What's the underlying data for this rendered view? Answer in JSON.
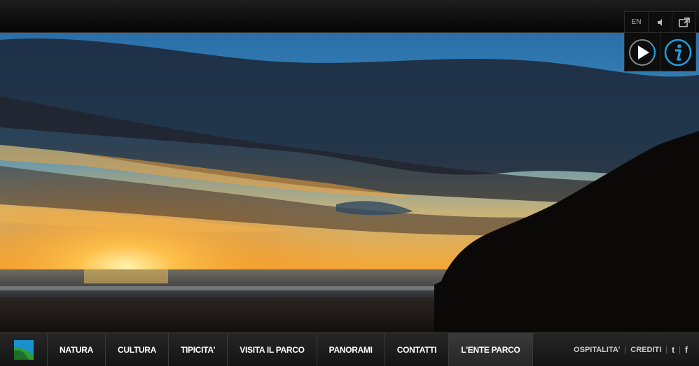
{
  "controls": {
    "language": "EN",
    "icons": [
      "volume-icon",
      "external-link-icon",
      "play-icon",
      "info-icon"
    ],
    "accent_color": "#1ea0e0"
  },
  "nav": {
    "items": [
      {
        "label": "NATURA"
      },
      {
        "label": "CULTURA"
      },
      {
        "label": "TIPICITA'"
      },
      {
        "label": "VISITA IL PARCO"
      },
      {
        "label": "PANORAMI"
      },
      {
        "label": "CONTATTI"
      },
      {
        "label": "L'ENTE PARCO",
        "active": true
      }
    ],
    "right": {
      "ospitalita": "OSPITALITA'",
      "crediti": "CREDITI",
      "sep": "|",
      "twitter": "t",
      "facebook": "f"
    }
  }
}
